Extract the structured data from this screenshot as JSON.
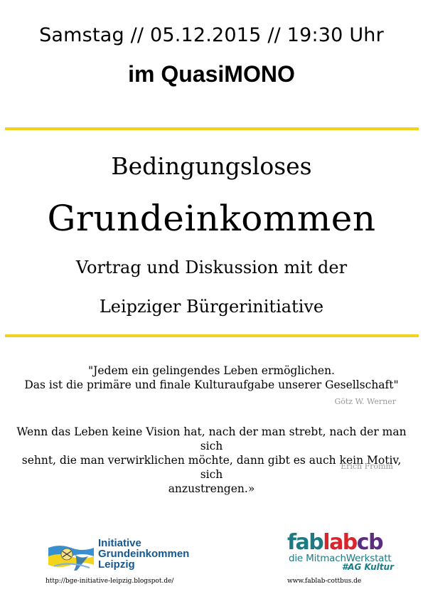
{
  "event": {
    "date_line": "Samstag // 05.12.2015 // 19:30 Uhr",
    "venue_line": "im QuasiMONO"
  },
  "headline": {
    "line1": "Bedingungsloses",
    "line2": "Grundeinkommen",
    "line3": "Vortrag und Diskussion mit der",
    "line4": "Leipziger Bürgerinitiative"
  },
  "quotes": [
    {
      "lines": [
        "\"Jedem ein gelingendes Leben ermöglichen.",
        "Das ist die primäre und finale Kulturaufgabe unserer Gesellschaft\""
      ],
      "author": "Götz W. Werner"
    },
    {
      "lines": [
        "Wenn das Leben keine Vision hat, nach der man strebt, nach der man sich",
        "sehnt, die man verwirklichen möchte, dann gibt es auch kein Motiv, sich",
        "anzustrengen.»"
      ],
      "author": "Erich Fromm"
    }
  ],
  "logos": {
    "left": {
      "lines": [
        "Initiative",
        "Grundeinkommen",
        "Leipzig"
      ],
      "url": "http://bge-initiative-leipzig.blogspot.de/",
      "color": "#15578f"
    },
    "right": {
      "word_parts": [
        {
          "text": "fab",
          "color": "#1c7a82"
        },
        {
          "text": "lab",
          "color": "#d9262e"
        },
        {
          "text": "cb",
          "color": "#5a2d82"
        }
      ],
      "subtitle": "die MitmachWerkstatt",
      "tag": "#AG Kultur",
      "url": "www.fablab-cottbus.de"
    }
  },
  "colors": {
    "rule": "#f2d21a",
    "author": "#9a9a9a"
  }
}
